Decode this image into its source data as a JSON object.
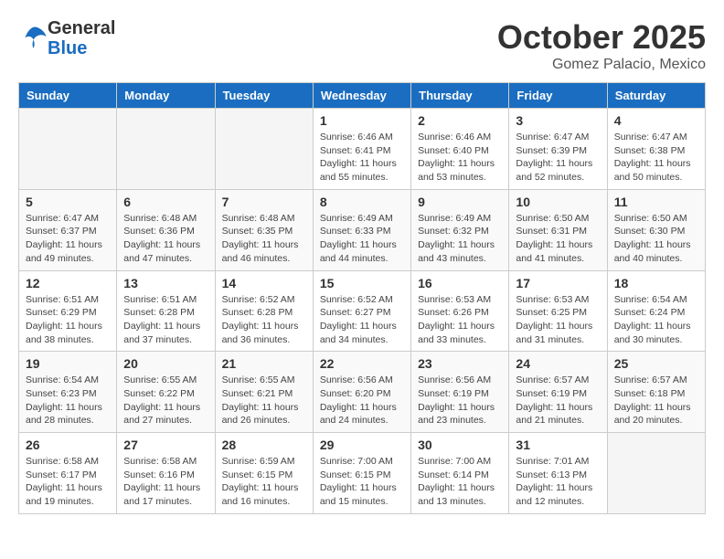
{
  "header": {
    "logo_line1": "General",
    "logo_line2": "Blue",
    "month": "October 2025",
    "location": "Gomez Palacio, Mexico"
  },
  "days_of_week": [
    "Sunday",
    "Monday",
    "Tuesday",
    "Wednesday",
    "Thursday",
    "Friday",
    "Saturday"
  ],
  "weeks": [
    [
      {
        "day": "",
        "sunrise": "",
        "sunset": "",
        "daylight": "",
        "empty": true
      },
      {
        "day": "",
        "sunrise": "",
        "sunset": "",
        "daylight": "",
        "empty": true
      },
      {
        "day": "",
        "sunrise": "",
        "sunset": "",
        "daylight": "",
        "empty": true
      },
      {
        "day": "1",
        "sunrise": "Sunrise: 6:46 AM",
        "sunset": "Sunset: 6:41 PM",
        "daylight": "Daylight: 11 hours and 55 minutes."
      },
      {
        "day": "2",
        "sunrise": "Sunrise: 6:46 AM",
        "sunset": "Sunset: 6:40 PM",
        "daylight": "Daylight: 11 hours and 53 minutes."
      },
      {
        "day": "3",
        "sunrise": "Sunrise: 6:47 AM",
        "sunset": "Sunset: 6:39 PM",
        "daylight": "Daylight: 11 hours and 52 minutes."
      },
      {
        "day": "4",
        "sunrise": "Sunrise: 6:47 AM",
        "sunset": "Sunset: 6:38 PM",
        "daylight": "Daylight: 11 hours and 50 minutes."
      }
    ],
    [
      {
        "day": "5",
        "sunrise": "Sunrise: 6:47 AM",
        "sunset": "Sunset: 6:37 PM",
        "daylight": "Daylight: 11 hours and 49 minutes."
      },
      {
        "day": "6",
        "sunrise": "Sunrise: 6:48 AM",
        "sunset": "Sunset: 6:36 PM",
        "daylight": "Daylight: 11 hours and 47 minutes."
      },
      {
        "day": "7",
        "sunrise": "Sunrise: 6:48 AM",
        "sunset": "Sunset: 6:35 PM",
        "daylight": "Daylight: 11 hours and 46 minutes."
      },
      {
        "day": "8",
        "sunrise": "Sunrise: 6:49 AM",
        "sunset": "Sunset: 6:33 PM",
        "daylight": "Daylight: 11 hours and 44 minutes."
      },
      {
        "day": "9",
        "sunrise": "Sunrise: 6:49 AM",
        "sunset": "Sunset: 6:32 PM",
        "daylight": "Daylight: 11 hours and 43 minutes."
      },
      {
        "day": "10",
        "sunrise": "Sunrise: 6:50 AM",
        "sunset": "Sunset: 6:31 PM",
        "daylight": "Daylight: 11 hours and 41 minutes."
      },
      {
        "day": "11",
        "sunrise": "Sunrise: 6:50 AM",
        "sunset": "Sunset: 6:30 PM",
        "daylight": "Daylight: 11 hours and 40 minutes."
      }
    ],
    [
      {
        "day": "12",
        "sunrise": "Sunrise: 6:51 AM",
        "sunset": "Sunset: 6:29 PM",
        "daylight": "Daylight: 11 hours and 38 minutes."
      },
      {
        "day": "13",
        "sunrise": "Sunrise: 6:51 AM",
        "sunset": "Sunset: 6:28 PM",
        "daylight": "Daylight: 11 hours and 37 minutes."
      },
      {
        "day": "14",
        "sunrise": "Sunrise: 6:52 AM",
        "sunset": "Sunset: 6:28 PM",
        "daylight": "Daylight: 11 hours and 36 minutes."
      },
      {
        "day": "15",
        "sunrise": "Sunrise: 6:52 AM",
        "sunset": "Sunset: 6:27 PM",
        "daylight": "Daylight: 11 hours and 34 minutes."
      },
      {
        "day": "16",
        "sunrise": "Sunrise: 6:53 AM",
        "sunset": "Sunset: 6:26 PM",
        "daylight": "Daylight: 11 hours and 33 minutes."
      },
      {
        "day": "17",
        "sunrise": "Sunrise: 6:53 AM",
        "sunset": "Sunset: 6:25 PM",
        "daylight": "Daylight: 11 hours and 31 minutes."
      },
      {
        "day": "18",
        "sunrise": "Sunrise: 6:54 AM",
        "sunset": "Sunset: 6:24 PM",
        "daylight": "Daylight: 11 hours and 30 minutes."
      }
    ],
    [
      {
        "day": "19",
        "sunrise": "Sunrise: 6:54 AM",
        "sunset": "Sunset: 6:23 PM",
        "daylight": "Daylight: 11 hours and 28 minutes."
      },
      {
        "day": "20",
        "sunrise": "Sunrise: 6:55 AM",
        "sunset": "Sunset: 6:22 PM",
        "daylight": "Daylight: 11 hours and 27 minutes."
      },
      {
        "day": "21",
        "sunrise": "Sunrise: 6:55 AM",
        "sunset": "Sunset: 6:21 PM",
        "daylight": "Daylight: 11 hours and 26 minutes."
      },
      {
        "day": "22",
        "sunrise": "Sunrise: 6:56 AM",
        "sunset": "Sunset: 6:20 PM",
        "daylight": "Daylight: 11 hours and 24 minutes."
      },
      {
        "day": "23",
        "sunrise": "Sunrise: 6:56 AM",
        "sunset": "Sunset: 6:19 PM",
        "daylight": "Daylight: 11 hours and 23 minutes."
      },
      {
        "day": "24",
        "sunrise": "Sunrise: 6:57 AM",
        "sunset": "Sunset: 6:19 PM",
        "daylight": "Daylight: 11 hours and 21 minutes."
      },
      {
        "day": "25",
        "sunrise": "Sunrise: 6:57 AM",
        "sunset": "Sunset: 6:18 PM",
        "daylight": "Daylight: 11 hours and 20 minutes."
      }
    ],
    [
      {
        "day": "26",
        "sunrise": "Sunrise: 6:58 AM",
        "sunset": "Sunset: 6:17 PM",
        "daylight": "Daylight: 11 hours and 19 minutes."
      },
      {
        "day": "27",
        "sunrise": "Sunrise: 6:58 AM",
        "sunset": "Sunset: 6:16 PM",
        "daylight": "Daylight: 11 hours and 17 minutes."
      },
      {
        "day": "28",
        "sunrise": "Sunrise: 6:59 AM",
        "sunset": "Sunset: 6:15 PM",
        "daylight": "Daylight: 11 hours and 16 minutes."
      },
      {
        "day": "29",
        "sunrise": "Sunrise: 7:00 AM",
        "sunset": "Sunset: 6:15 PM",
        "daylight": "Daylight: 11 hours and 15 minutes."
      },
      {
        "day": "30",
        "sunrise": "Sunrise: 7:00 AM",
        "sunset": "Sunset: 6:14 PM",
        "daylight": "Daylight: 11 hours and 13 minutes."
      },
      {
        "day": "31",
        "sunrise": "Sunrise: 7:01 AM",
        "sunset": "Sunset: 6:13 PM",
        "daylight": "Daylight: 11 hours and 12 minutes."
      },
      {
        "day": "",
        "sunrise": "",
        "sunset": "",
        "daylight": "",
        "empty": true
      }
    ]
  ]
}
